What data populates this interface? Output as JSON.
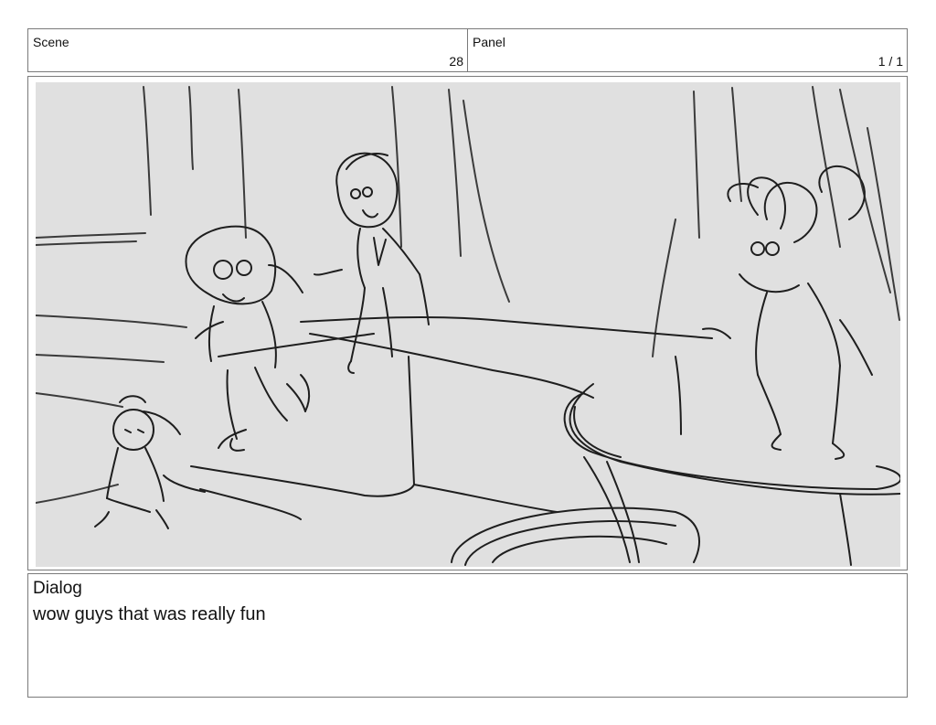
{
  "scene": {
    "label": "Scene",
    "value": "28"
  },
  "panel": {
    "label": "Panel",
    "value": "1 / 1"
  },
  "dialog": {
    "label": "Dialog",
    "text": "wow guys that was really fun"
  },
  "artwork": {
    "background_color": "#e0e0e0",
    "stroke_color": "#1e1e1e"
  }
}
